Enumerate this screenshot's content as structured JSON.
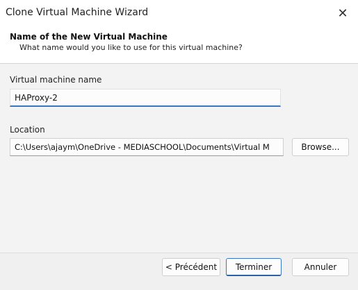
{
  "window": {
    "title": "Clone Virtual Machine Wizard",
    "close_glyph": "✕"
  },
  "header": {
    "title": "Name of the New Virtual Machine",
    "subtitle": "What name would you like to use for this virtual machine?"
  },
  "form": {
    "vm_name_label": "Virtual machine name",
    "vm_name_value": "HAProxy-2",
    "location_label": "Location",
    "location_value": "C:\\Users\\ajaym\\OneDrive - MEDIASCHOOL\\Documents\\Virtual M",
    "browse_label": "Browse..."
  },
  "footer": {
    "back_label": "< Précédent",
    "finish_label": "Terminer",
    "cancel_label": "Annuler"
  },
  "colors": {
    "accent": "#3a77c2",
    "background": "#f0f0f0"
  }
}
